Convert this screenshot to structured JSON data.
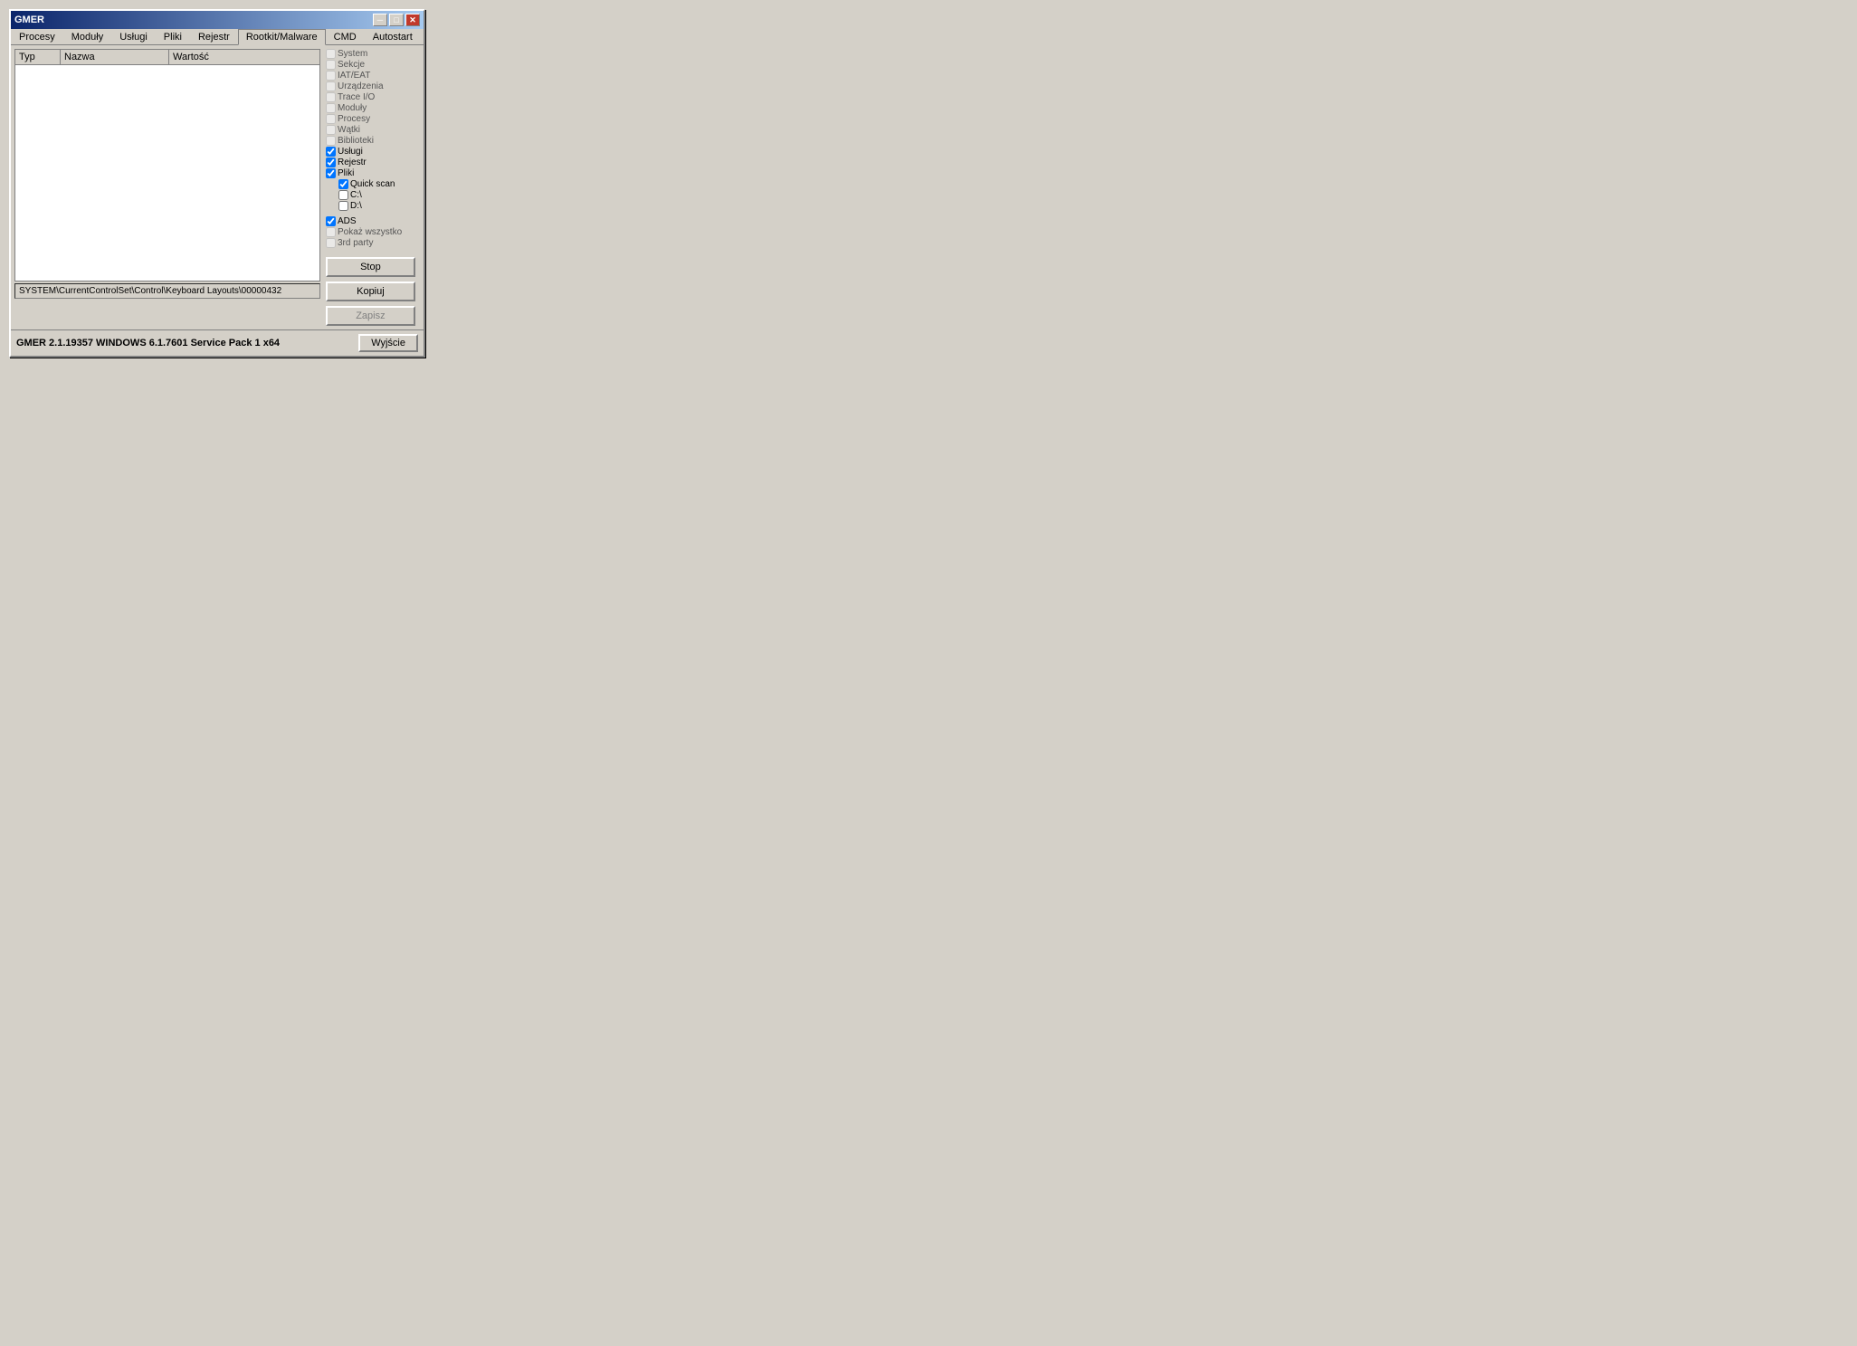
{
  "window": {
    "title": "GMER"
  },
  "title_bar": {
    "min_btn": "0",
    "max_btn": "1",
    "close_btn": "✕"
  },
  "tabs": [
    {
      "label": "Procesy",
      "active": false
    },
    {
      "label": "Moduły",
      "active": false
    },
    {
      "label": "Usługi",
      "active": false
    },
    {
      "label": "Pliki",
      "active": false
    },
    {
      "label": "Rejestr",
      "active": false
    },
    {
      "label": "Rootkit/Malware",
      "active": true
    },
    {
      "label": "CMD",
      "active": false
    },
    {
      "label": "Autostart",
      "active": false
    }
  ],
  "table": {
    "columns": [
      {
        "label": "Typ",
        "key": "typ"
      },
      {
        "label": "Nazwa",
        "key": "nazwa"
      },
      {
        "label": "Wartość",
        "key": "wartosc"
      }
    ],
    "rows": []
  },
  "status_bar": {
    "text": "SYSTEM\\CurrentControlSet\\Control\\Keyboard Layouts\\00000432"
  },
  "right_panel": {
    "checkboxes": [
      {
        "label": "System",
        "checked": false,
        "enabled": false
      },
      {
        "label": "Sekcje",
        "checked": false,
        "enabled": false
      },
      {
        "label": "IAT/EAT",
        "checked": false,
        "enabled": false
      },
      {
        "label": "Urządzenia",
        "checked": false,
        "enabled": false
      },
      {
        "label": "Trace I/O",
        "checked": false,
        "enabled": false
      },
      {
        "label": "Moduły",
        "checked": false,
        "enabled": false
      },
      {
        "label": "Procesy",
        "checked": false,
        "enabled": false
      },
      {
        "label": "Wątki",
        "checked": false,
        "enabled": false
      },
      {
        "label": "Biblioteki",
        "checked": false,
        "enabled": false
      },
      {
        "label": "Usługi",
        "checked": true,
        "enabled": true
      },
      {
        "label": "Rejestr",
        "checked": true,
        "enabled": true
      },
      {
        "label": "Pliki",
        "checked": true,
        "enabled": true
      }
    ],
    "pliki_sub": [
      {
        "label": "Quick scan",
        "checked": true,
        "enabled": true
      },
      {
        "label": "C:\\",
        "checked": false,
        "enabled": true
      },
      {
        "label": "D:\\",
        "checked": false,
        "enabled": true
      }
    ],
    "ads_checkbox": {
      "label": "ADS",
      "checked": true,
      "enabled": true
    },
    "pokaz_checkbox": {
      "label": "Pokaż wszystko",
      "checked": false,
      "enabled": false
    },
    "third_party_checkbox": {
      "label": "3rd party",
      "checked": false,
      "enabled": false
    },
    "buttons": {
      "stop": "Stop",
      "kopiuj": "Kopiuj",
      "zapisz": "Zapisz"
    }
  },
  "bottom_bar": {
    "version_text": "GMER 2.1.19357    WINDOWS 6.1.7601 Service Pack 1 x64",
    "exit_btn": "Wyjście"
  }
}
